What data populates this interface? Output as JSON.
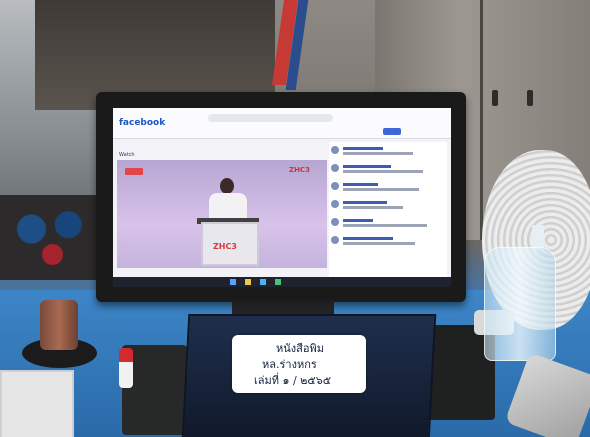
{
  "screen": {
    "site_logo": "facebook",
    "tab_label": "Watch",
    "video_logo": "ZHC3",
    "podium_logo": "ZHC3",
    "caption": ""
  },
  "label_card": {
    "line1": "หนังสือพิม",
    "line2": "หล.ร่างหกร",
    "line3": "เล่มที่ ๑ / ๒๕๖๕"
  },
  "colors": {
    "desk": "#2f6eac",
    "live_badge": "#e0454a",
    "brand": "#1c57c4"
  }
}
